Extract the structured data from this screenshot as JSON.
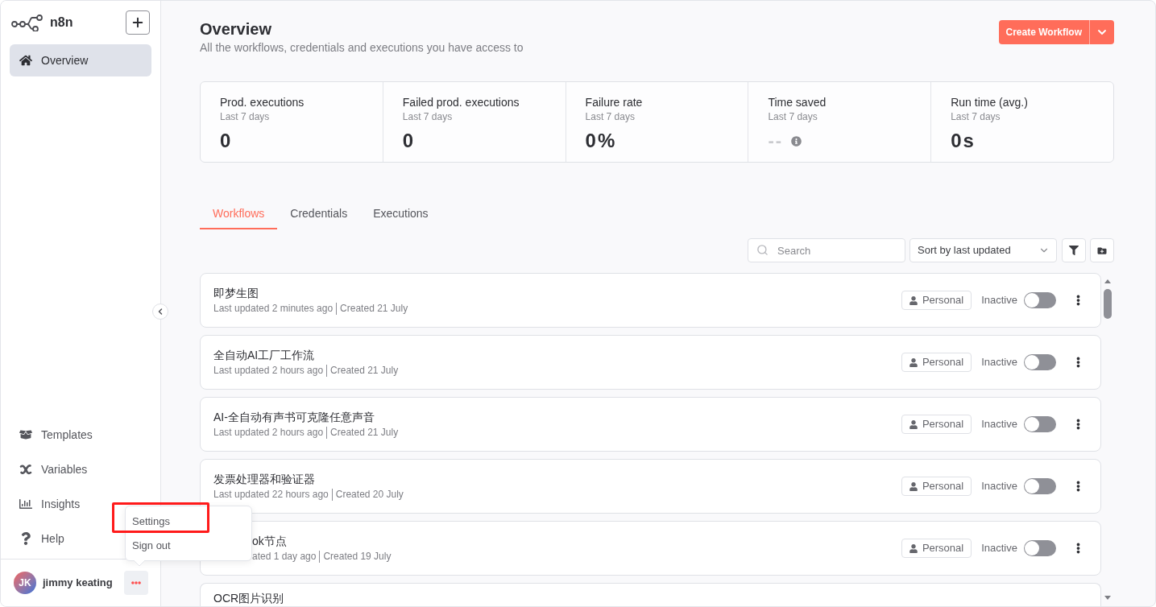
{
  "sidebar": {
    "brand": "n8n",
    "nav": [
      {
        "label": "Overview",
        "selected": true
      }
    ],
    "bottom_nav": [
      {
        "label": "Templates",
        "selected": false
      },
      {
        "label": "Variables",
        "selected": false
      },
      {
        "label": "Insights",
        "selected": false
      },
      {
        "label": "Help",
        "selected": false
      }
    ],
    "user": {
      "initials": "JK",
      "name": "jimmy keating"
    }
  },
  "user_menu": {
    "items": [
      {
        "label": "Settings",
        "highlighted": true
      },
      {
        "label": "Sign out",
        "highlighted": false
      }
    ]
  },
  "header": {
    "title": "Overview",
    "subtitle": "All the workflows, credentials and executions you have access to",
    "create_button": "Create Workflow"
  },
  "stats": [
    {
      "kind": "number",
      "label": "Prod. executions",
      "period": "Last 7 days",
      "value": "0"
    },
    {
      "kind": "number",
      "label": "Failed prod. executions",
      "period": "Last 7 days",
      "value": "0"
    },
    {
      "kind": "number",
      "label": "Failure rate",
      "period": "Last 7 days",
      "value": "0",
      "unit": "%"
    },
    {
      "kind": "empty",
      "label": "Time saved",
      "period": "Last 7 days",
      "value": "--"
    },
    {
      "kind": "number",
      "label": "Run time (avg.)",
      "period": "Last 7 days",
      "value": "0",
      "unit": "s"
    }
  ],
  "tabs": [
    {
      "label": "Workflows",
      "selected": true
    },
    {
      "label": "Credentials",
      "selected": false
    },
    {
      "label": "Executions",
      "selected": false
    }
  ],
  "toolbar": {
    "search": {
      "placeholder": "Search"
    },
    "sort": {
      "value": "Sort by last updated"
    }
  },
  "workflows": [
    {
      "kind": "full",
      "title": "即梦生图",
      "updated": "Last updated 2 minutes ago",
      "created": "Created 21 July",
      "owner": "Personal",
      "status": "Inactive",
      "active": false
    },
    {
      "kind": "full",
      "title": "全自动AI工厂工作流",
      "updated": "Last updated 2 hours ago",
      "created": "Created 21 July",
      "owner": "Personal",
      "status": "Inactive",
      "active": false
    },
    {
      "kind": "full",
      "title": "AI-全自动有声书可克隆任意声音",
      "updated": "Last updated 2 hours ago",
      "created": "Created 21 July",
      "owner": "Personal",
      "status": "Inactive",
      "active": false
    },
    {
      "kind": "full",
      "title": "发票处理器和验证器",
      "updated": "Last updated 22 hours ago",
      "created": "Created 20 July",
      "owner": "Personal",
      "status": "Inactive",
      "active": false
    },
    {
      "kind": "under_menu",
      "title": "ok节点",
      "updated": "ated 1 day ago",
      "created": "Created 19 July",
      "owner": "Personal",
      "status": "Inactive",
      "active": false
    },
    {
      "kind": "cut_off",
      "title": "OCR图片识别"
    }
  ]
}
